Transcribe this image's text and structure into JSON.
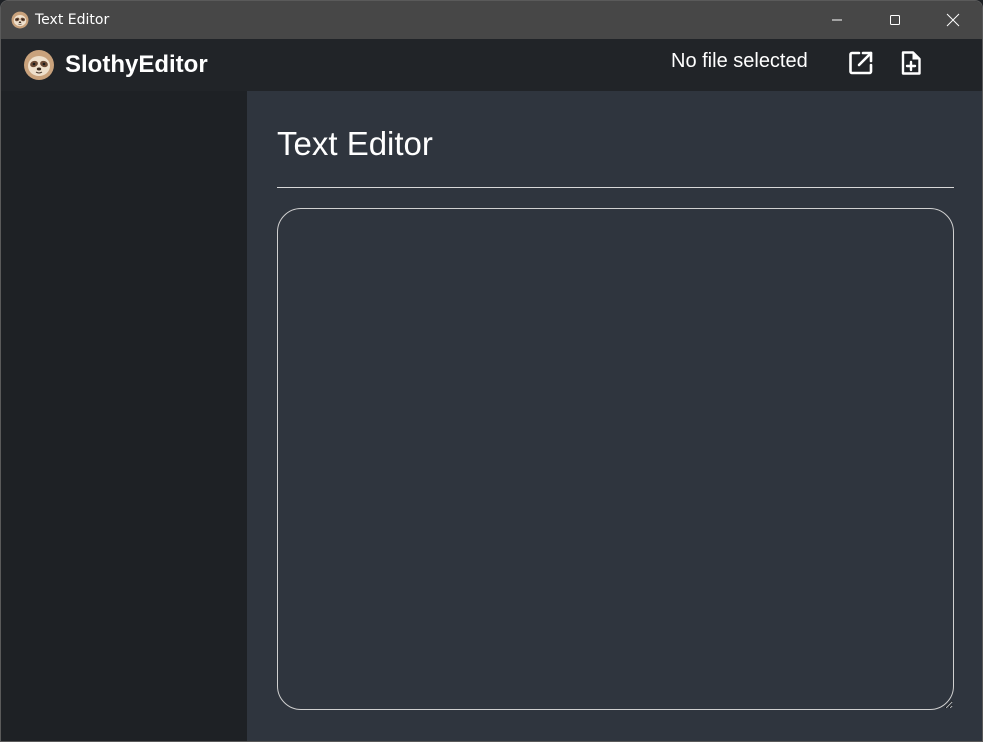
{
  "window": {
    "title": "Text Editor",
    "icon": "sloth-icon",
    "controls": [
      "minimize-icon",
      "maximize-icon",
      "close-icon"
    ]
  },
  "header": {
    "app_name": "SlothyEditor",
    "logo_icon": "sloth-icon",
    "file_status": "No file selected",
    "open_file_icon": "open-external-icon",
    "new_file_icon": "new-file-icon"
  },
  "main": {
    "heading": "Text Editor",
    "editor": {
      "value": "",
      "placeholder": ""
    }
  },
  "colors": {
    "titlebar": "#474747",
    "appbar": "#212428",
    "sidebar": "#1e2125",
    "main": "#2f353e",
    "text": "#ffffff",
    "border": "#d0d0d0"
  }
}
